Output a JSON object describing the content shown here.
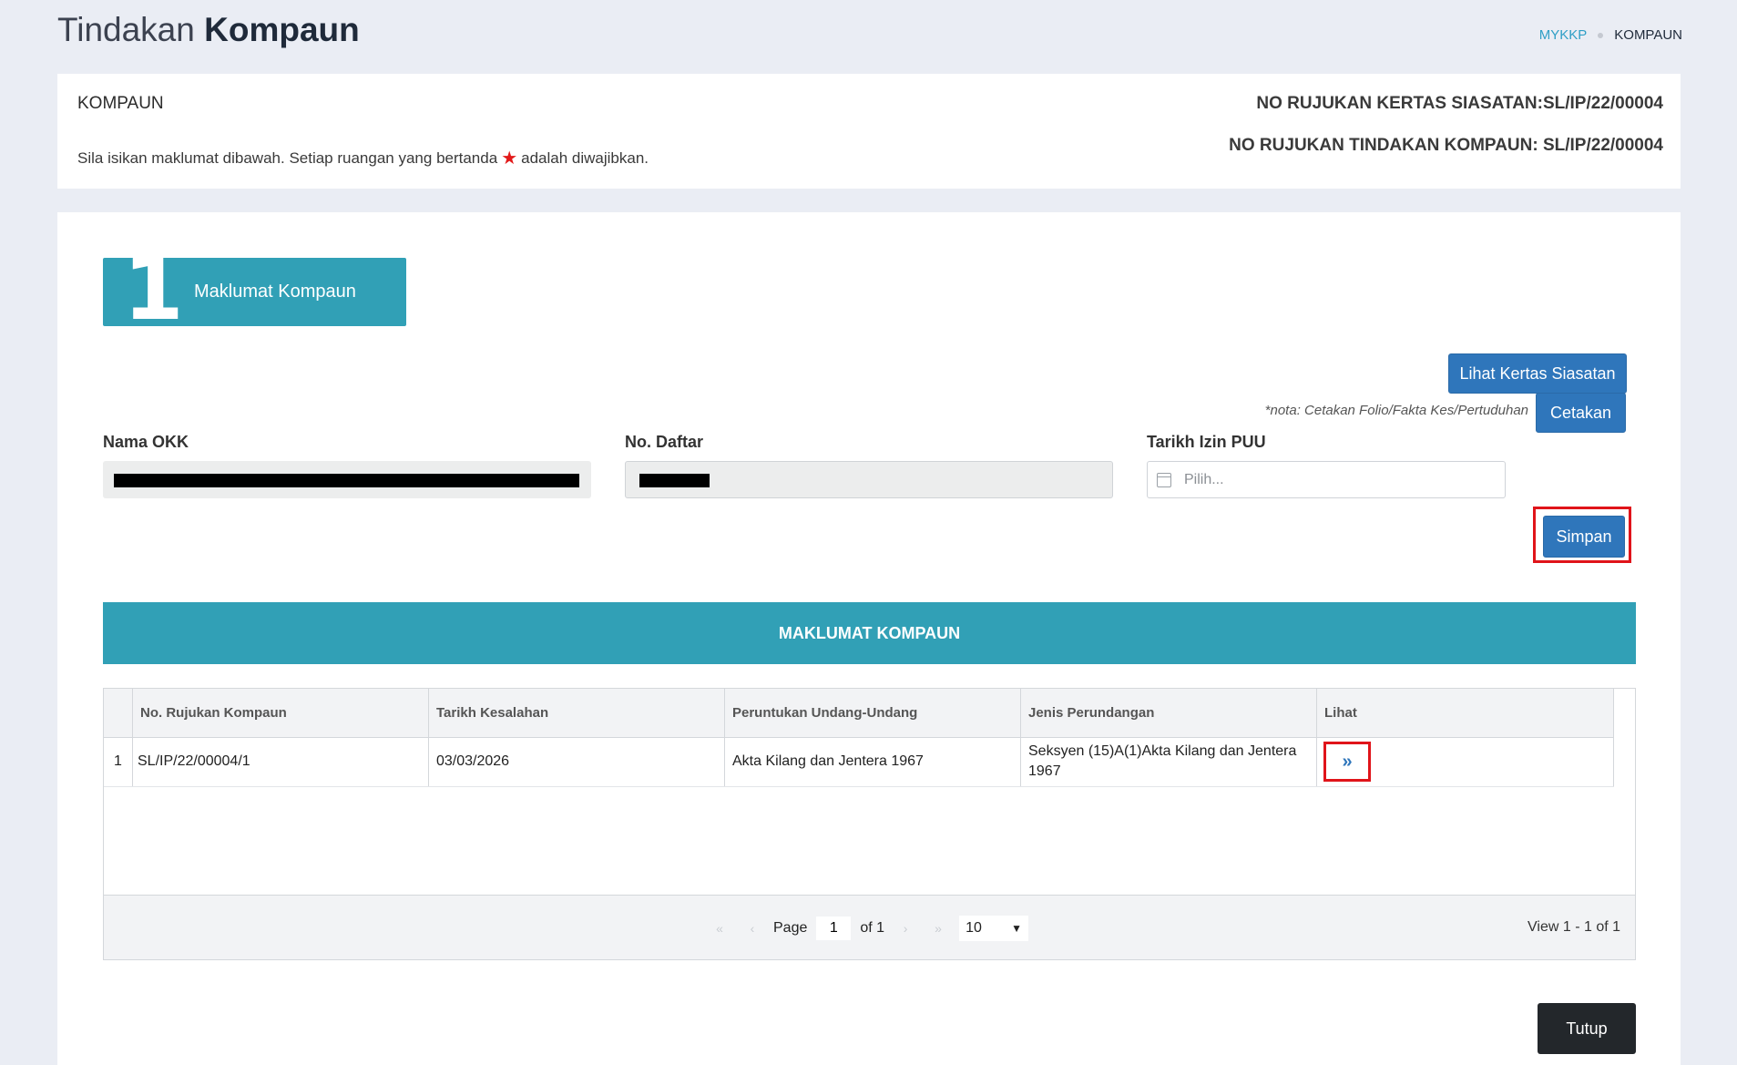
{
  "page": {
    "title_light": "Tindakan",
    "title_bold": "Kompaun"
  },
  "breadcrumb": {
    "home": "MYKKP",
    "current": "KOMPAUN"
  },
  "header": {
    "title": "KOMPAUN",
    "note_before": "Sila isikan maklumat dibawah. Setiap ruangan yang bertanda",
    "note_after": "adalah diwajibkan.",
    "ref_kertas": "NO RUJUKAN KERTAS SIASATAN:SL/IP/22/00004",
    "ref_tindakan": "NO RUJUKAN TINDAKAN KOMPAUN: SL/IP/22/00004"
  },
  "step": {
    "number": "1",
    "label": "Maklumat Kompaun"
  },
  "actions": {
    "lihat_kertas": "Lihat Kertas Siasatan",
    "nota": "*nota: Cetakan Folio/Fakta Kes/Pertuduhan",
    "cetakan": "Cetakan",
    "simpan": "Simpan",
    "tutup": "Tutup"
  },
  "form": {
    "nama_okk_label": "Nama OKK",
    "no_daftar_label": "No. Daftar",
    "tarikh_label": "Tarikh Izin PUU",
    "tarikh_placeholder": "Pilih..."
  },
  "section": {
    "title": "MAKLUMAT KOMPAUN"
  },
  "table": {
    "columns": [
      "",
      "No. Rujukan Kompaun",
      "Tarikh Kesalahan",
      "Peruntukan Undang-Undang",
      "Jenis Perundangan",
      "Lihat"
    ],
    "rows": [
      {
        "no": "1",
        "rujukan": "SL/IP/22/00004/1",
        "tarikh": "03/03/2026",
        "peruntukan": "Akta Kilang dan Jentera 1967",
        "jenis": "Seksyen (15)A(1)Akta Kilang dan Jentera 1967"
      }
    ]
  },
  "pager": {
    "page_label": "Page",
    "page_value": "1",
    "of_label": "of 1",
    "page_size": "10",
    "view_text": "View 1 - 1 of 1"
  },
  "colors": {
    "teal": "#31a0b6",
    "primary": "#2f76bb",
    "highlight": "#e0141a",
    "dark": "#23272b"
  }
}
